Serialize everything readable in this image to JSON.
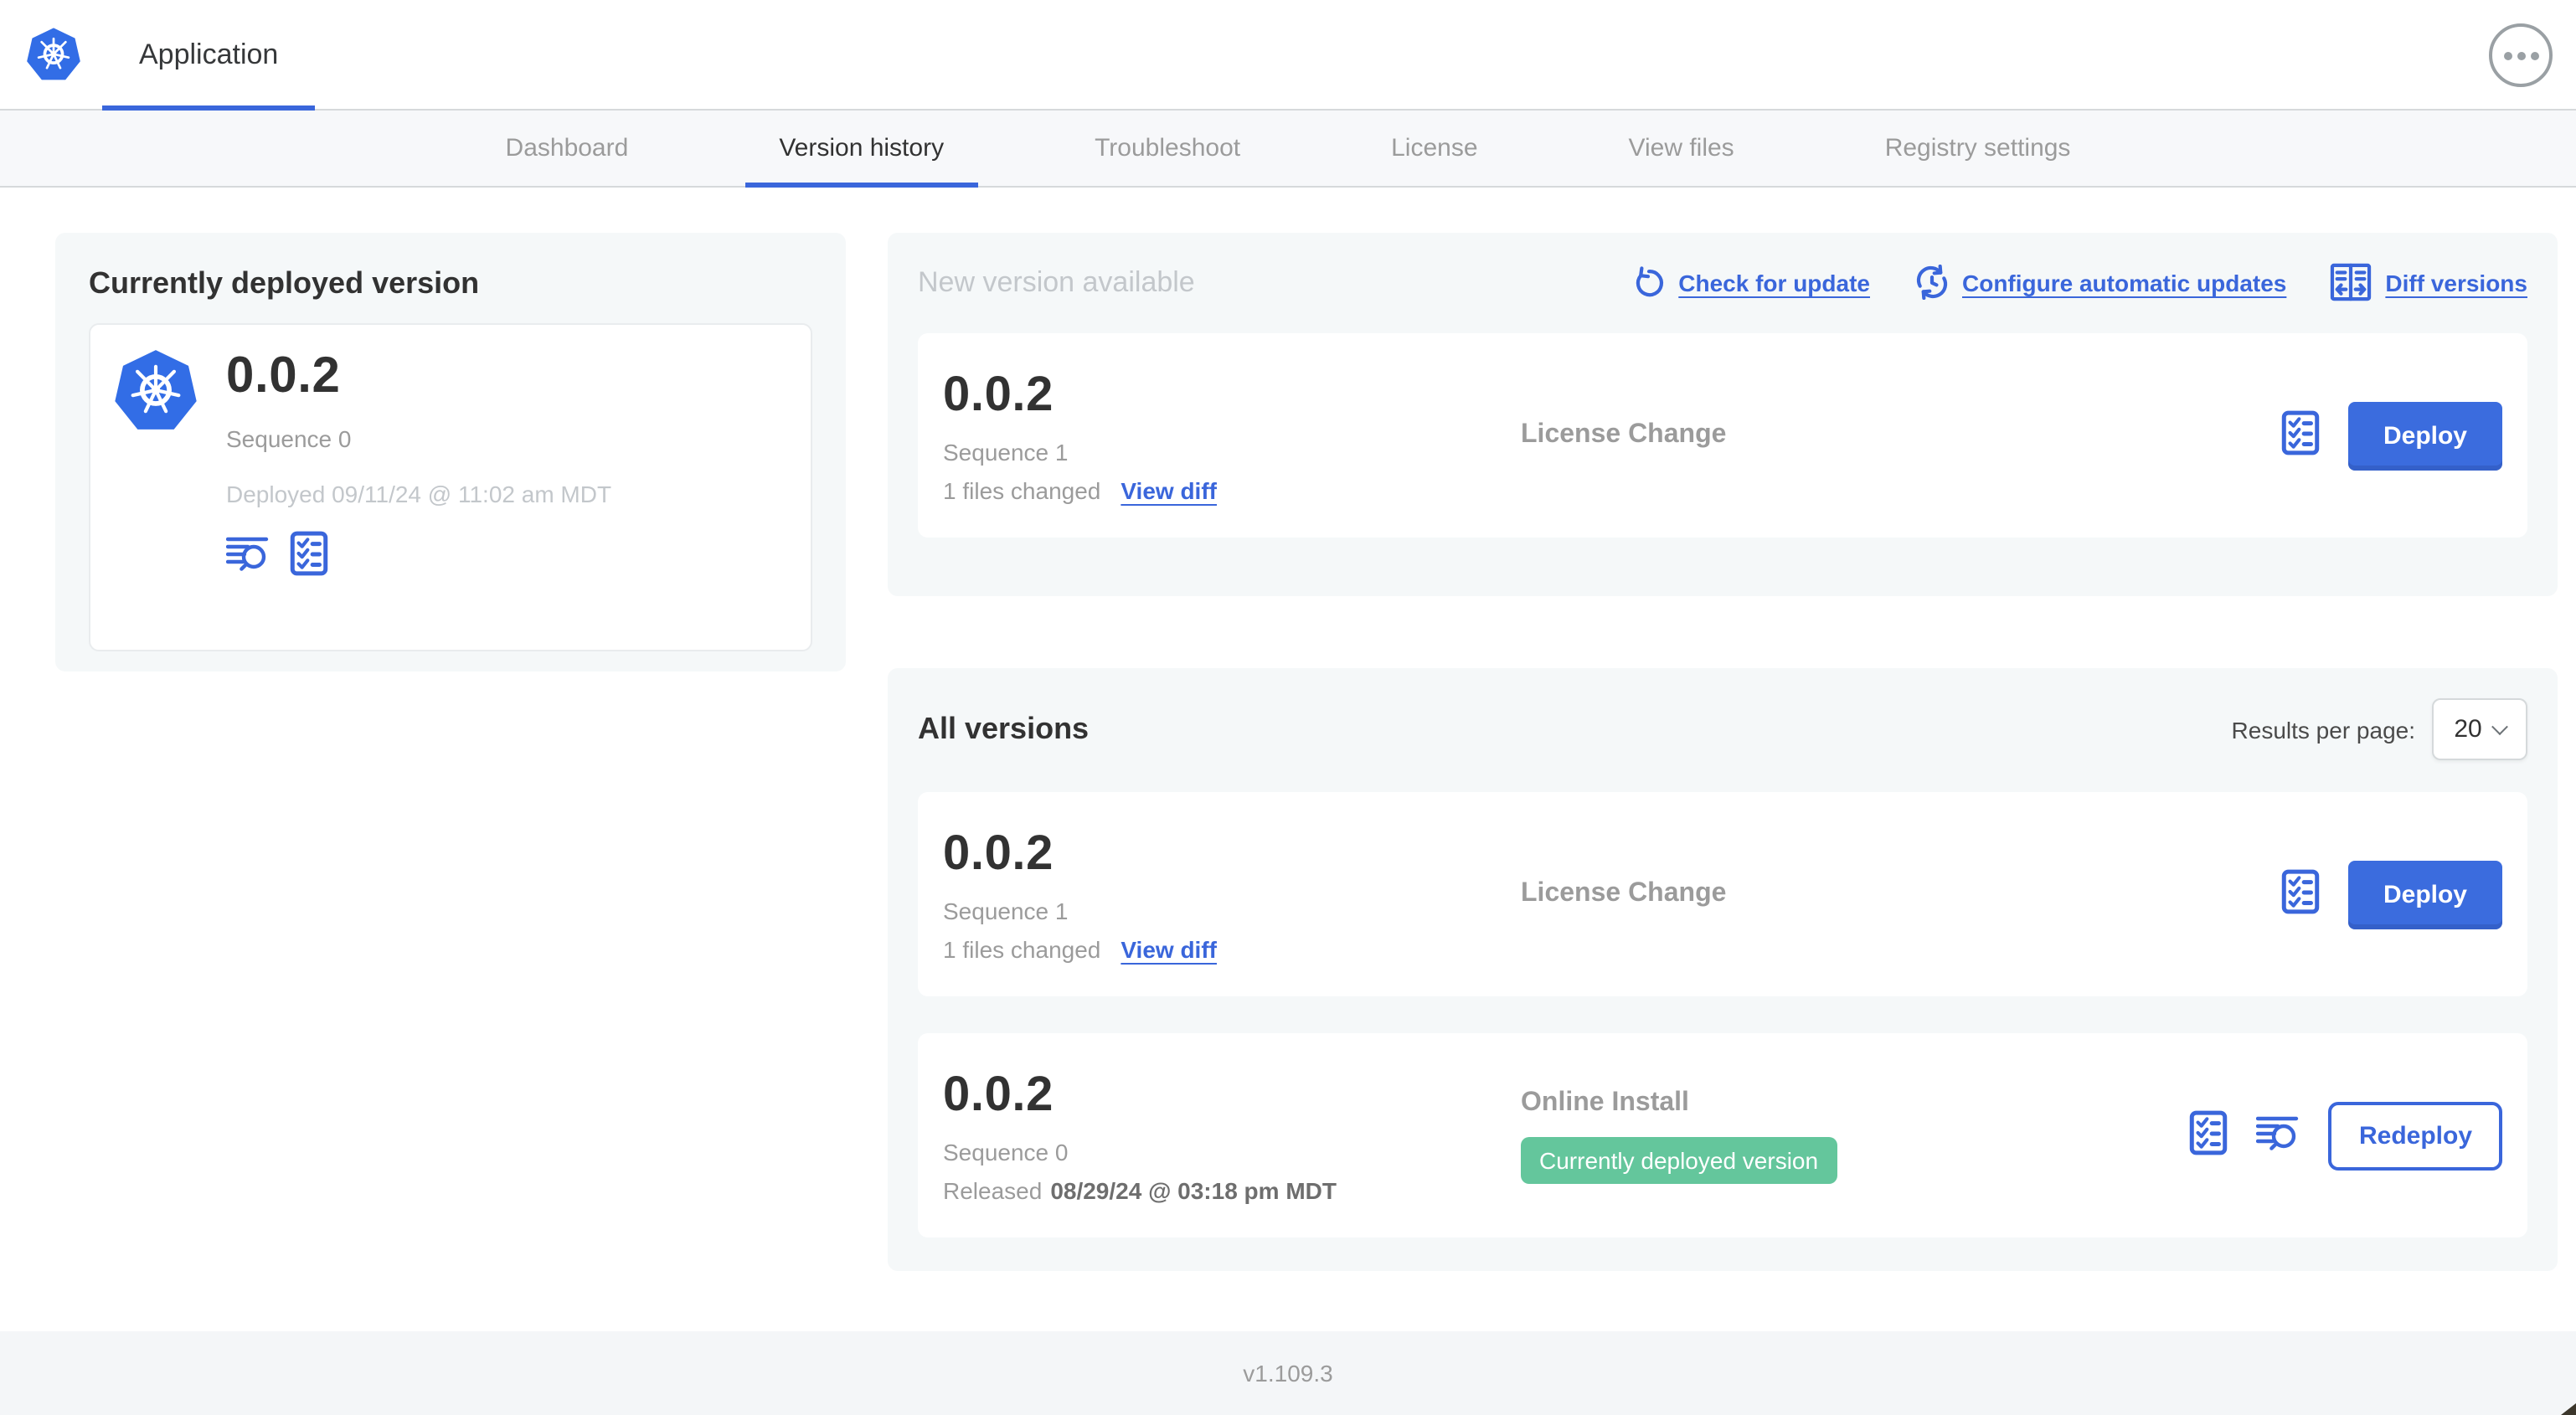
{
  "colors": {
    "accent": "#3A66DB",
    "button_blue": "#3B6CDE",
    "badge_green": "#64C69C",
    "k8s_blue": "#326DE6"
  },
  "header": {
    "app_tab": "Application"
  },
  "nav": {
    "tabs": [
      {
        "label": "Dashboard",
        "active": false
      },
      {
        "label": "Version history",
        "active": true
      },
      {
        "label": "Troubleshoot",
        "active": false
      },
      {
        "label": "License",
        "active": false
      },
      {
        "label": "View files",
        "active": false
      },
      {
        "label": "Registry settings",
        "active": false
      }
    ]
  },
  "current_version": {
    "title": "Currently deployed version",
    "version": "0.0.2",
    "sequence": "Sequence 0",
    "deployed": "Deployed 09/11/24 @ 11:02 am MDT"
  },
  "new_version": {
    "title": "New version available",
    "actions": {
      "check": "Check for update",
      "configure": "Configure automatic updates",
      "diff": "Diff versions"
    },
    "card": {
      "version": "0.0.2",
      "sequence": "Sequence 1",
      "files_changed": "1 files changed",
      "view_diff": "View diff",
      "source": "License Change",
      "deploy_label": "Deploy"
    }
  },
  "all_versions": {
    "title": "All versions",
    "results_per_page_label": "Results per page:",
    "results_per_page_value": "20",
    "rows": [
      {
        "version": "0.0.2",
        "sequence": "Sequence 1",
        "files_changed": "1 files changed",
        "view_diff": "View diff",
        "source": "License Change",
        "action_label": "Deploy"
      },
      {
        "version": "0.0.2",
        "sequence": "Sequence 0",
        "released_prefix": "Released",
        "released_date": "08/29/24 @ 03:18 pm MDT",
        "source": "Online Install",
        "badge": "Currently deployed version",
        "action_label": "Redeploy"
      }
    ]
  },
  "footer": {
    "app_version": "v1.109.3"
  },
  "icons": {
    "logo": "kubernetes-wheel",
    "more_menu": "ellipsis-circle",
    "check_update": "refresh-arrow",
    "configure_updates": "clock-refresh",
    "diff": "split-columns-arrows",
    "preflight": "checklist",
    "logs": "lines-magnifier",
    "select_chevron": "chevron-down"
  }
}
